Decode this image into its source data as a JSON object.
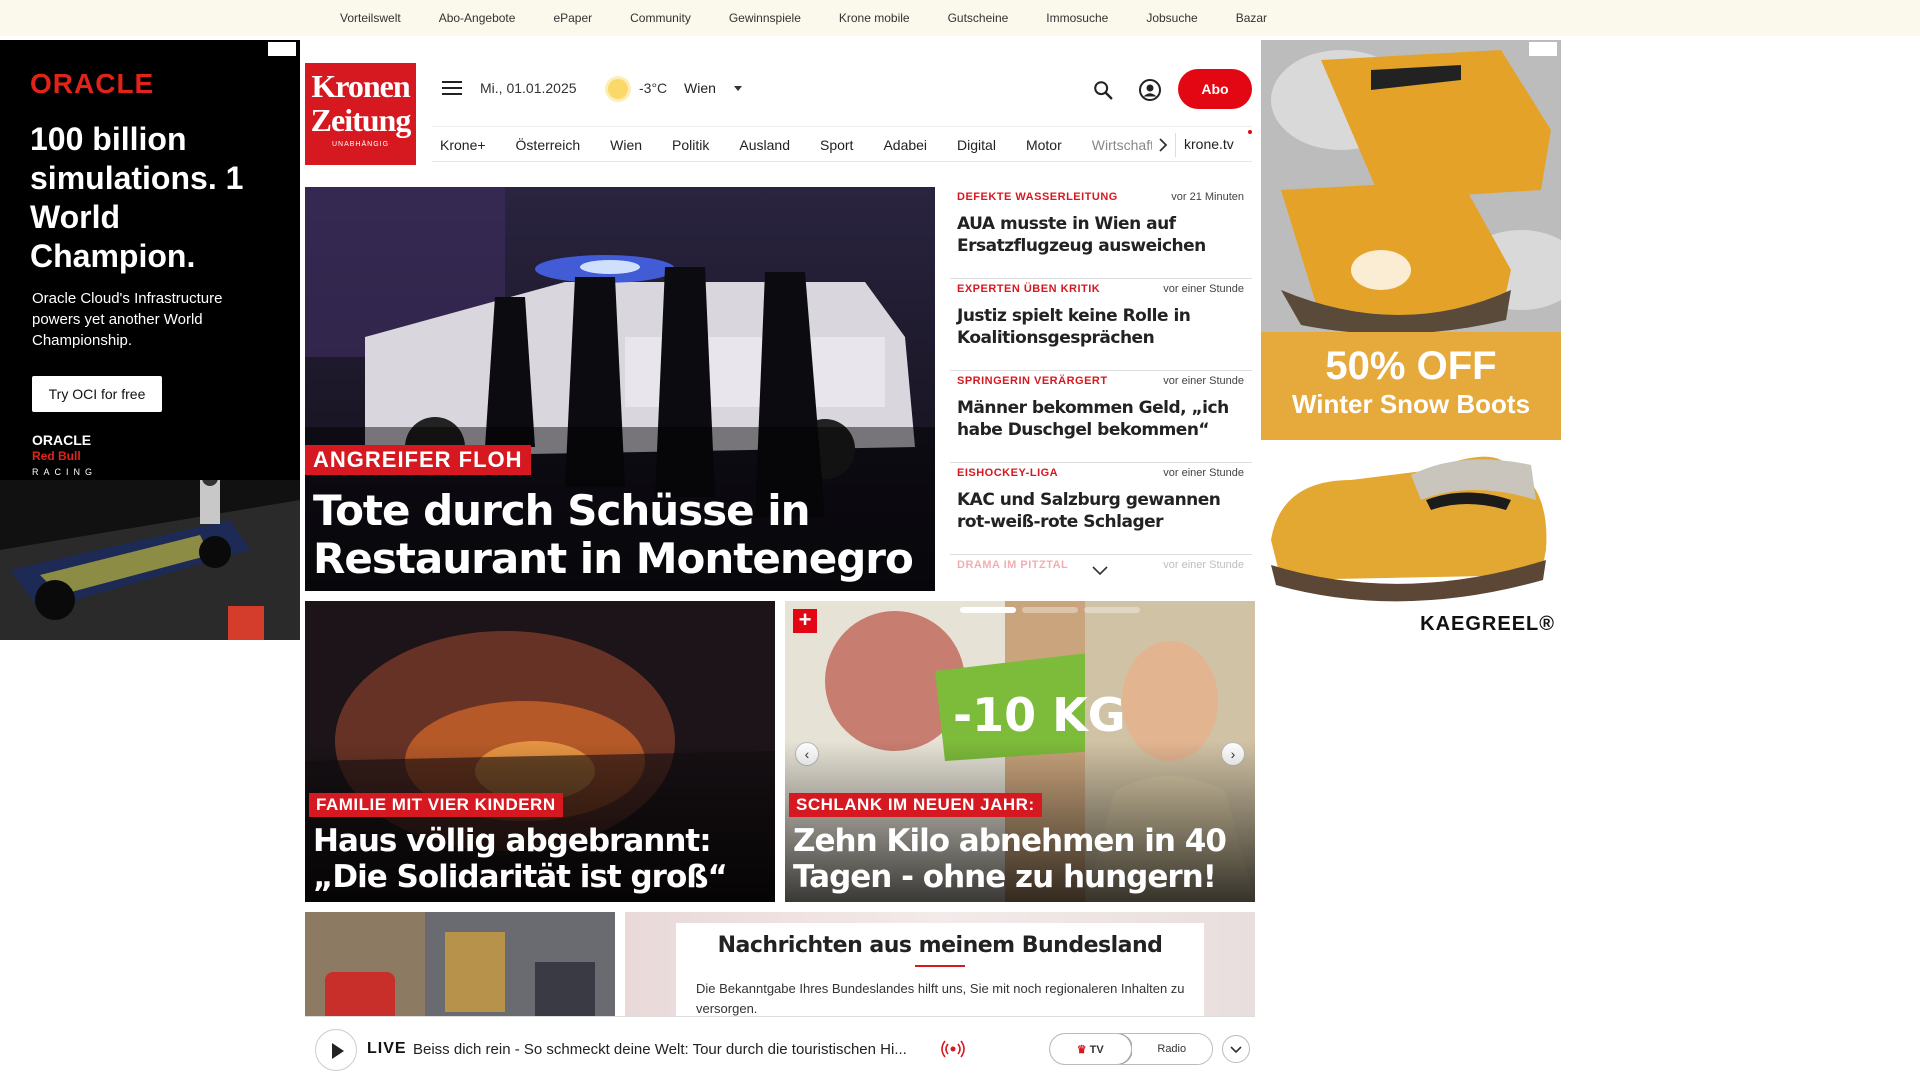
{
  "topbar": {
    "links": [
      "Vorteilswelt",
      "Abo-Angebote",
      "ePaper",
      "Community",
      "Gewinnspiele",
      "Krone mobile",
      "Gutscheine",
      "Immosuche",
      "Jobsuche",
      "Bazar"
    ]
  },
  "logo": {
    "line1": "Kronen",
    "line2": "Zeitung",
    "tagline": "UNABHÄNGIG"
  },
  "header": {
    "date": "Mi., 01.01.2025",
    "temperature": "-3°C",
    "city": "Wien",
    "abo_label": "Abo"
  },
  "nav": {
    "tabs": [
      "Krone+",
      "Österreich",
      "Wien",
      "Politik",
      "Ausland",
      "Sport",
      "Adabei",
      "Digital",
      "Motor",
      "Wirtschaft"
    ],
    "ktv": "krone.tv"
  },
  "hero": {
    "kicker": "ANGREIFER FLOH",
    "title": "Tote durch Schüsse in Restaurant in Montenegro"
  },
  "ticker": [
    {
      "category": "DEFEKTE WASSERLEITUNG",
      "time": "vor 21 Minuten",
      "headline": "AUA musste in Wien auf Ersatzflugzeug ausweichen"
    },
    {
      "category": "EXPERTEN ÜBEN KRITIK",
      "time": "vor einer Stunde",
      "headline": "Justiz spielt keine Rolle in Koalitionsgesprächen"
    },
    {
      "category": "SPRINGERIN VERÄRGERT",
      "time": "vor einer Stunde",
      "headline": "Männer bekommen Geld, „ich habe Duschgel bekommen“"
    },
    {
      "category": "EISHOCKEY-LIGA",
      "time": "vor einer Stunde",
      "headline": "KAC und Salzburg gewannen rot-weiß-rote Schlager"
    },
    {
      "category": "DRAMA IM PITZTAL",
      "time": "vor einer Stunde",
      "headline": ""
    }
  ],
  "cards": [
    {
      "kicker": "FAMILIE MIT VIER KINDERN",
      "title": "Haus völlig abgebrannt: „Die Solidarität ist groß“"
    },
    {
      "kicker": "SCHLANK IM NEUEN JAHR:",
      "title": "Zehn Kilo abnehmen in 40 Tagen - ohne zu hungern!",
      "badge": "+",
      "image_text": "-10 KG"
    }
  ],
  "bundesland": {
    "title": "Nachrichten aus meinem Bundesland",
    "text": "Die Bekanntgabe Ihres Bundeslandes hilft uns, Sie mit noch regionaleren Inhalten zu versorgen."
  },
  "player": {
    "live": "LIVE",
    "description": "Beiss dich rein - So schmeckt deine Welt: Tour durch die touristischen Hi...",
    "tv": "TV",
    "radio": "Radio"
  },
  "ad_left": {
    "brand": "ORACLE",
    "headline": "100 billion simulations. 1 World Champion.",
    "sub": "Oracle Cloud's Infrastructure powers yet another World Championship.",
    "cta": "Try OCI for free",
    "racing": [
      "ORACLE",
      "Red Bull",
      "RACING"
    ]
  },
  "ad_right": {
    "promo_big": "50% OFF",
    "promo_small": "Winter Snow Boots",
    "brand": "KAEGREEL®"
  },
  "colors": {
    "accent": "#d61920",
    "abo": "#e30613",
    "topbar_bg": "#fbf8ec"
  }
}
